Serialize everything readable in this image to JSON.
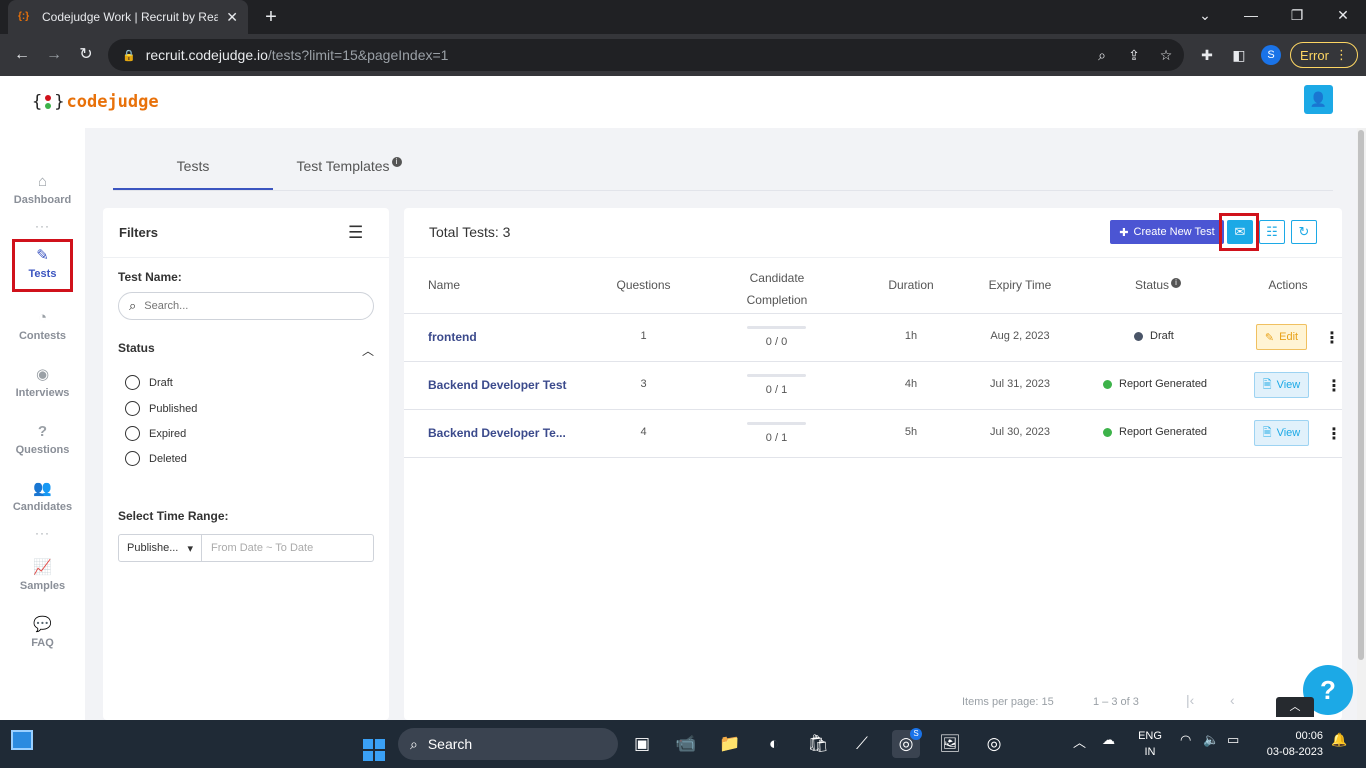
{
  "browser": {
    "tab_title": "Codejudge Work | Recruit by Real",
    "url_host": "recruit.codejudge.io",
    "url_path": "/tests?limit=15&pageIndex=1",
    "profile_initial": "S",
    "error_label": "Error"
  },
  "app": {
    "logo_text": "codejudge",
    "brace_open": "{",
    "brace_close": "}"
  },
  "sidebar": {
    "items": [
      {
        "label": "Dashboard",
        "icon": "home-icon"
      },
      {
        "label": "Tests",
        "icon": "pencil-icon"
      },
      {
        "label": "Contests",
        "icon": "pie-chart-icon"
      },
      {
        "label": "Interviews",
        "icon": "podcast-icon"
      },
      {
        "label": "Questions",
        "icon": "question-circle-icon"
      },
      {
        "label": "Candidates",
        "icon": "users-icon"
      },
      {
        "label": "Samples",
        "icon": "chart-icon"
      },
      {
        "label": "FAQ",
        "icon": "comments-icon"
      }
    ],
    "dots": "···"
  },
  "tabs": {
    "tests": "Tests",
    "templates": "Test Templates",
    "info_glyph": "i"
  },
  "filters": {
    "title": "Filters",
    "test_name_label": "Test Name:",
    "search_placeholder": "Search...",
    "status_label": "Status",
    "statuses": [
      "Draft",
      "Published",
      "Expired",
      "Deleted"
    ],
    "time_range_label": "Select Time Range:",
    "time_select_value": "Publishe...",
    "date_placeholder": "From Date ~ To Date"
  },
  "main": {
    "total_label": "Total Tests: 3",
    "create_label": "Create New Test",
    "columns": {
      "name": "Name",
      "questions": "Questions",
      "candidate_completion_1": "Candidate",
      "candidate_completion_2": "Completion",
      "duration": "Duration",
      "expiry": "Expiry Time",
      "status": "Status",
      "actions": "Actions"
    },
    "rows": [
      {
        "name": "frontend",
        "questions": "1",
        "completion": "0 / 0",
        "completion_fraction": 0,
        "duration": "1h",
        "expiry": "Aug 2, 2023",
        "status": "Draft",
        "status_color": "#4a5568",
        "action": "Edit"
      },
      {
        "name": "Backend Developer Test",
        "questions": "3",
        "completion": "0 / 1",
        "completion_fraction": 0,
        "duration": "4h",
        "expiry": "Jul 31, 2023",
        "status": "Report Generated",
        "status_color": "#3db34a",
        "action": "View"
      },
      {
        "name": "Backend Developer Te...",
        "questions": "4",
        "completion": "0 / 1",
        "completion_fraction": 0,
        "duration": "5h",
        "expiry": "Jul 30, 2023",
        "status": "Report Generated",
        "status_color": "#3db34a",
        "action": "View"
      }
    ],
    "pager": {
      "items_per_page_label": "Items per page:",
      "items_per_page": "15",
      "range": "1 – 3 of 3"
    }
  },
  "help_label": "?",
  "taskbar": {
    "search_label": "Search",
    "lang_1": "ENG",
    "lang_2": "IN",
    "time": "00:06",
    "date": "03-08-2023",
    "chrome_badge": "S"
  },
  "colors": {
    "accent": "#3c55c0",
    "highlight": "#d0111b",
    "info_blue": "#1ca9e6",
    "create": "#4b55d3"
  }
}
